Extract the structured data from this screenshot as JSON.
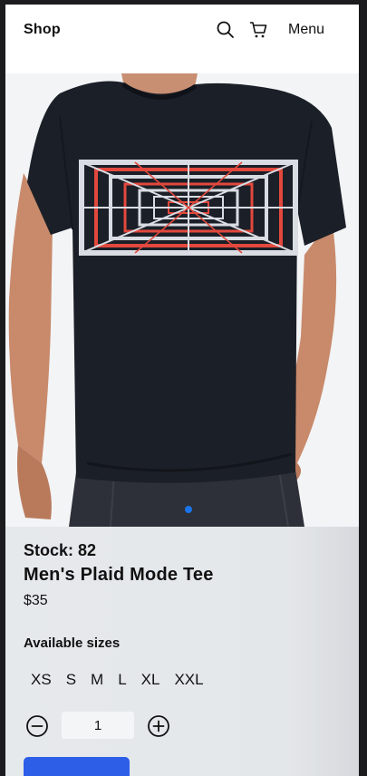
{
  "header": {
    "brand": "Shop",
    "menu_label": "Menu",
    "icons": [
      "search-icon",
      "cart-icon"
    ]
  },
  "hero": {
    "image": "product-photo",
    "carousel_active_index": 0,
    "carousel_dot_color": "#1a73e8"
  },
  "product": {
    "stock": "Stock: 82",
    "name": "Men's Plaid Mode Tee",
    "price": "$35"
  },
  "sizes": {
    "label": "Available sizes",
    "options": [
      "XS",
      "S",
      "M",
      "L",
      "XL",
      "XXL"
    ]
  },
  "quantity": {
    "value": "1",
    "decrement_icon": "minus-circle-icon",
    "increment_icon": "plus-circle-icon"
  },
  "colors": {
    "accent": "#2c5ee8",
    "panel": "#e6e9ec",
    "shirt": "#1b1f27",
    "print_red": "#e2483d"
  }
}
